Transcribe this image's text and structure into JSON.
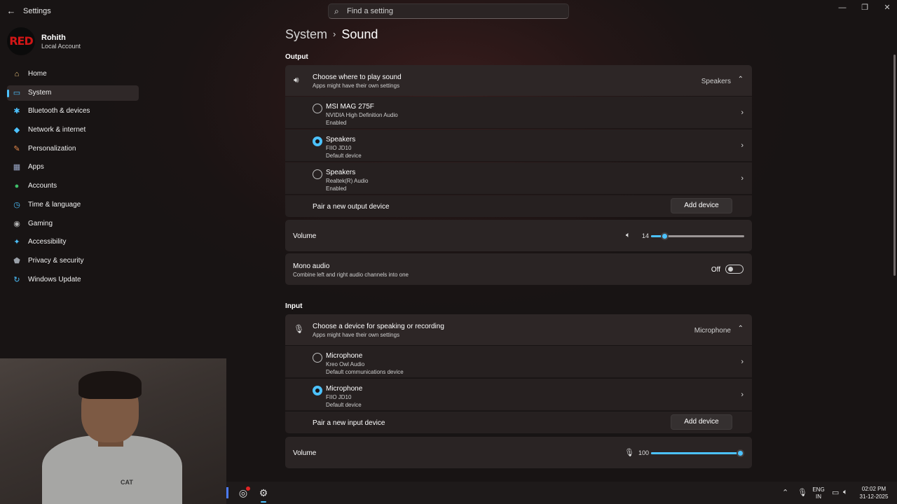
{
  "app": {
    "title": "Settings"
  },
  "search": {
    "placeholder": "Find a setting"
  },
  "account": {
    "name": "Rohith",
    "type": "Local Account",
    "avatar_text": "RED"
  },
  "nav": {
    "items": [
      {
        "label": "Home",
        "icon": "home-icon",
        "color": "#e8c07a"
      },
      {
        "label": "System",
        "icon": "system-icon",
        "color": "#4cc2ff"
      },
      {
        "label": "Bluetooth & devices",
        "icon": "bluetooth-icon",
        "color": "#4cc2ff"
      },
      {
        "label": "Network & internet",
        "icon": "wifi-icon",
        "color": "#4cc2ff"
      },
      {
        "label": "Personalization",
        "icon": "brush-icon",
        "color": "#e88a4c"
      },
      {
        "label": "Apps",
        "icon": "apps-icon",
        "color": "#9aa8c8"
      },
      {
        "label": "Accounts",
        "icon": "person-icon",
        "color": "#3fbf6a"
      },
      {
        "label": "Time & language",
        "icon": "clock-globe-icon",
        "color": "#4cc2ff"
      },
      {
        "label": "Gaming",
        "icon": "controller-icon",
        "color": "#b0b0b0"
      },
      {
        "label": "Accessibility",
        "icon": "accessibility-icon",
        "color": "#4cc2ff"
      },
      {
        "label": "Privacy & security",
        "icon": "shield-icon",
        "color": "#9aa0a8"
      },
      {
        "label": "Windows Update",
        "icon": "update-icon",
        "color": "#4cc2ff"
      }
    ],
    "active_index": 1
  },
  "breadcrumb": {
    "parent": "System",
    "current": "Sound"
  },
  "output": {
    "heading": "Output",
    "header": {
      "title": "Choose where to play sound",
      "subtitle": "Apps might have their own settings",
      "value": "Speakers"
    },
    "devices": [
      {
        "name": "MSI MAG 275F",
        "driver": "NVIDIA High Definition Audio",
        "status": "Enabled",
        "selected": false
      },
      {
        "name": "Speakers",
        "driver": "FIIO JD10",
        "status": "Default device",
        "selected": true
      },
      {
        "name": "Speakers",
        "driver": "Realtek(R) Audio",
        "status": "Enabled",
        "selected": false
      }
    ],
    "pair_label": "Pair a new output device",
    "add_button": "Add device",
    "volume_label": "Volume",
    "volume_value": "14",
    "volume_fraction": 0.14,
    "mono": {
      "title": "Mono audio",
      "subtitle": "Combine left and right audio channels into one",
      "state_label": "Off",
      "on": false
    }
  },
  "input": {
    "heading": "Input",
    "header": {
      "title": "Choose a device for speaking or recording",
      "subtitle": "Apps might have their own settings",
      "value": "Microphone"
    },
    "devices": [
      {
        "name": "Microphone",
        "driver": "Kreo Owl Audio",
        "status": "Default communications device",
        "selected": false
      },
      {
        "name": "Microphone",
        "driver": "FIIO JD10",
        "status": "Default device",
        "selected": true
      }
    ],
    "pair_label": "Pair a new input device",
    "add_button": "Add device",
    "volume_label": "Volume",
    "volume_value": "100",
    "volume_fraction": 1.0
  },
  "taskbar": {
    "lang_top": "ENG",
    "lang_bottom": "IN",
    "time": "02:02 PM",
    "date": "31-12-2025"
  },
  "colors": {
    "accent": "#4cc2ff"
  }
}
